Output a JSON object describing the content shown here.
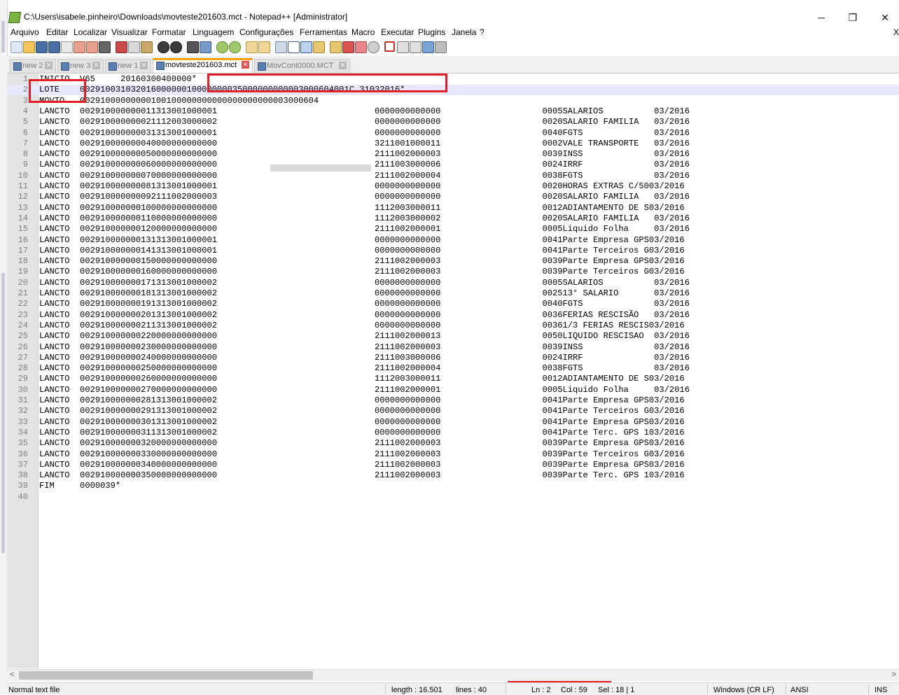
{
  "window": {
    "title": "C:\\Users\\isabele.pinheiro\\Downloads\\movteste201603.mct - Notepad++ [Administrator]",
    "minimize": "─",
    "restore": "❐",
    "close": "✕"
  },
  "menu": {
    "items": [
      "Arquivo",
      "Editar",
      "Localizar",
      "Visualizar",
      "Formatar",
      "Linguagem",
      "Configurações",
      "Ferramentas",
      "Macro",
      "Executar",
      "Plugins",
      "Janela",
      "?"
    ],
    "close": "X"
  },
  "tabs": [
    {
      "label": "new 2",
      "active": false
    },
    {
      "label": "new 3",
      "active": false
    },
    {
      "label": "new 1",
      "active": false
    },
    {
      "label": "movteste201603.mct",
      "active": true
    },
    {
      "label": "MovCont0000.MCT",
      "active": false
    }
  ],
  "tab_close_glyph": "✕",
  "editor": {
    "current_line": 2,
    "lines": [
      "INICIO  V65     20160300400000*",
      "LOTE    00291003103201600000010000000035000000000003000604001C 31032016*",
      "MOVTO   00291000000000100100000000000000000000003000604",
      "LANCTO  002910000000011313001000001                               0000000000000                    0005SALARIOS          03/2016",
      "LANCTO  002910000000021112003000002                               0000000000000                    0020SALARIO FAMILIA   03/2016",
      "LANCTO  002910000000031313001000001                               0000000000000                    0040FGTS              03/2016",
      "LANCTO  002910000000040000000000000                               3211001000011                    0002VALE TRANSPORTE   03/2016",
      "LANCTO  002910000000050000000000000                               2111002000003                    0039INSS              03/2016",
      "LANCTO  002910000000060000000000000                               2111003000006                    0024IRRF              03/2016",
      "LANCTO  002910000000070000000000000                               2111002000004                    0038FGTS              03/2016",
      "LANCTO  002910000000081313001000001                               0000000000000                    0020HORAS EXTRAS C/5003/2016",
      "LANCTO  002910000000092111002000003                               0000000000000                    0020SALARIO FAMILIA   03/2016",
      "LANCTO  002910000000100000000000000                               1112003000011                    0012ADIANTAMENTO DE S03/2016",
      "LANCTO  002910000000110000000000000                               1112003000002                    0020SALARIO FAMILIA   03/2016",
      "LANCTO  002910000000120000000000000                               2111002000001                    0005Liquido Folha     03/2016",
      "LANCTO  002910000000131313001000001                               0000000000000                    0041Parte Empresa GPS03/2016",
      "LANCTO  002910000000141313001000001                               0000000000000                    0041Parte Terceiros G03/2016",
      "LANCTO  002910000000150000000000000                               2111002000003                    0039Parte Empresa GPS03/2016",
      "LANCTO  002910000000160000000000000                               2111002000003                    0039Parte Terceiros G03/2016",
      "LANCTO  002910000000171313001000002                               0000000000000                    0005SALARIOS          03/2016",
      "LANCTO  002910000000181313001000002                               0000000000000                    002513° SALARIO       03/2016",
      "LANCTO  002910000000191313001000002                               0000000000000                    0040FGTS              03/2016",
      "LANCTO  002910000000201313001000002                               0000000000000                    0036FERIAS RESCISÃO   03/2016",
      "LANCTO  002910000000211313001000002                               0000000000000                    00361/3 FERIAS RESCIS03/2016",
      "LANCTO  002910000000220000000000000                               2111002000013                    0050LIQUIDO RESCISAO  03/2016",
      "LANCTO  002910000000230000000000000                               2111002000003                    0039INSS              03/2016",
      "LANCTO  002910000000240000000000000                               2111003000006                    0024IRRF              03/2016",
      "LANCTO  002910000000250000000000000                               2111002000004                    0038FGTS              03/2016",
      "LANCTO  002910000000260000000000000                               1112003000011                    0012ADIANTAMENTO DE S03/2016",
      "LANCTO  002910000000270000000000000                               2111002000001                    0005Liquido Folha     03/2016",
      "LANCTO  002910000000281313001000002                               0000000000000                    0041Parte Empresa GPS03/2016",
      "LANCTO  002910000000291313001000002                               0000000000000                    0041Parte Terceiros G03/2016",
      "LANCTO  002910000000301313001000002                               0000000000000                    0041Parte Empresa GPS03/2016",
      "LANCTO  002910000000311313001000002                               0000000000000                    0041Parte Terc. GPS 103/2016",
      "LANCTO  002910000000320000000000000                               2111002000003                    0039Parte Empresa GPS03/2016",
      "LANCTO  002910000000330000000000000                               2111002000003                    0039Parte Terceiros G03/2016",
      "LANCTO  002910000000340000000000000                               2111002000003                    0039Parte Empresa GPS03/2016",
      "LANCTO  002910000000350000000000000                               2111002000003                    0039Parte Terc. GPS 103/2016",
      "FIM     0000039*",
      ""
    ]
  },
  "status": {
    "file_type": "Normal text file",
    "length": "length : 16.501",
    "lines": "lines : 40",
    "ln": "Ln : 2",
    "col": "Col : 59",
    "sel": "Sel : 18 | 1",
    "eol": "Windows (CR LF)",
    "encoding": "ANSI",
    "mode": "INS"
  },
  "hscroll": {
    "left": "<",
    "right": ">"
  }
}
